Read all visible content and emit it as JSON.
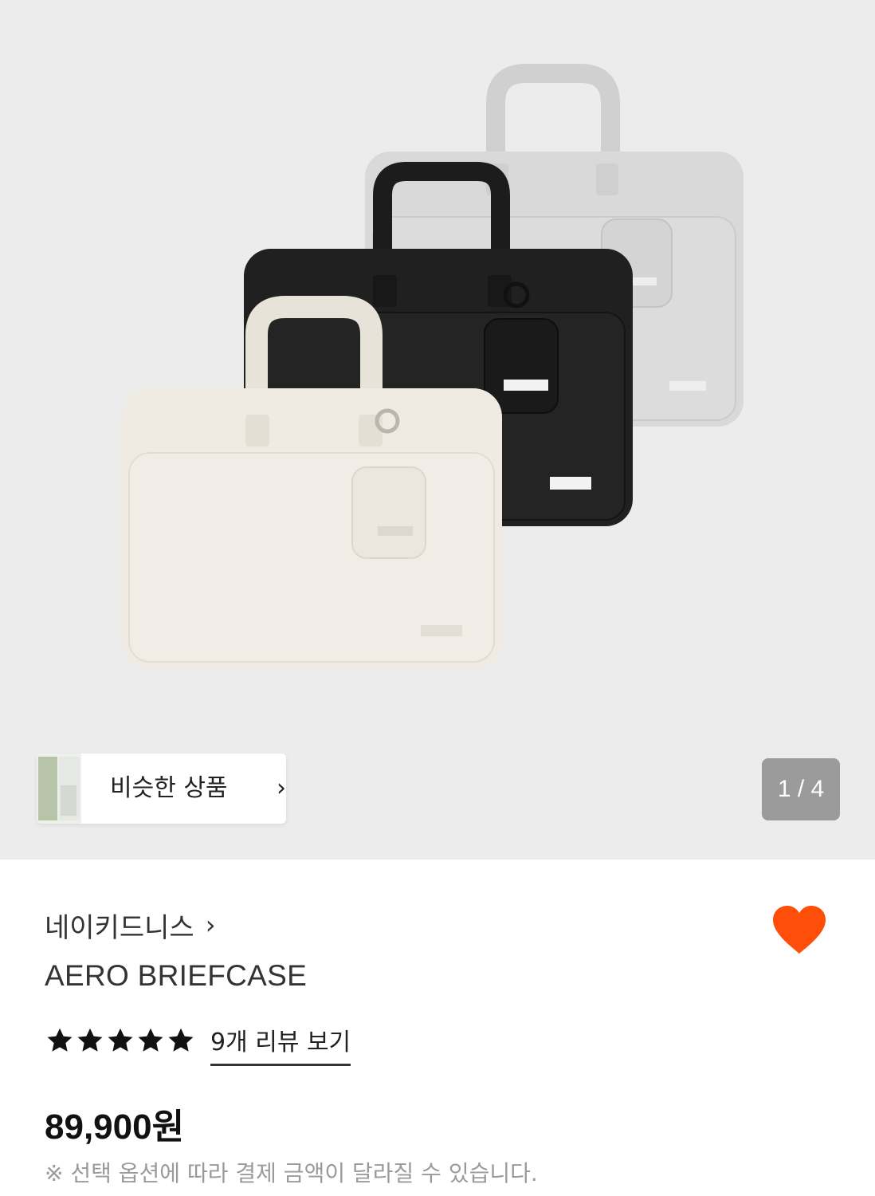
{
  "gallery": {
    "page_current": "1",
    "page_separator": "/",
    "page_total": "4",
    "page_indicator_text": "1 / 4"
  },
  "similar": {
    "label": "비슷한 상품",
    "chevron": "›"
  },
  "product": {
    "brand": "네이키드니스",
    "brand_chevron": "›",
    "title": "AERO BRIEFCASE",
    "rating_stars": 5,
    "review_link": "9개 리뷰 보기",
    "price": "89,900원",
    "notice": "※ 선택 옵션에 따라 결제 금액이 달라질 수 있습니다."
  },
  "colors": {
    "accent_heart": "#ff4d0a",
    "hero_background": "#ececec",
    "indicator_bg": "#9b9b9b"
  },
  "icons": {
    "wishlist": "heart-icon",
    "star": "star-icon",
    "chevron": "chevron-right-icon"
  }
}
